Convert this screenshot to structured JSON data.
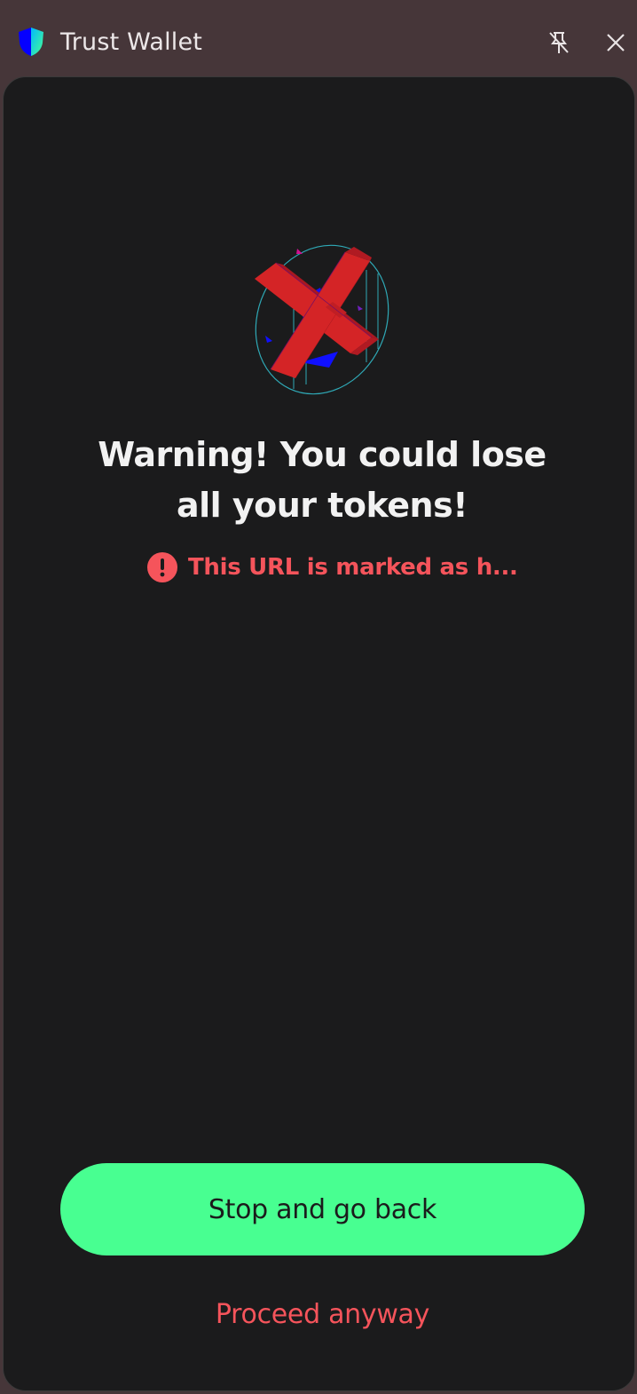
{
  "window": {
    "title": "Trust Wallet",
    "logo_icon": "trust-wallet-shield-icon",
    "pin_icon": "unpin-icon",
    "close_icon": "close-icon"
  },
  "warning": {
    "illustration": "red-x-warning-icon",
    "heading": "Warning! You could lose all your tokens!",
    "message_icon": "exclamation-circle-icon",
    "message": "This URL is marked as h..."
  },
  "actions": {
    "stop_label": "Stop and go back",
    "proceed_label": "Proceed anyway"
  },
  "colors": {
    "titlebar_bg": "#463639",
    "panel_bg": "#1b1b1c",
    "primary_button": "#48ff91",
    "danger": "#f5545b",
    "heading_text": "#f2f2f2"
  }
}
